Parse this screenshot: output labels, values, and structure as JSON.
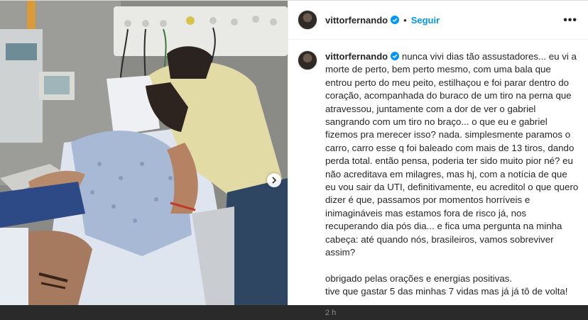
{
  "post": {
    "username": "vittorfernando",
    "follow_label": "Seguir",
    "separator": "•",
    "more_label": "•••",
    "caption_text": "nunca vivi dias tão assustadores... eu vi a morte de perto, bem perto mesmo, com uma bala que entrou perto do meu peito, estilhaçou e foi parar dentro do coração, acompanhada do buraco de um tiro na perna que atravessou, juntamente com a dor de ver o gabriel sangrando com um tiro no braço... o que eu e gabriel fizemos pra merecer isso? nada. simplesmente paramos o carro, carro esse q foi baleado com mais de 13 tiros, dando perda total. então pensa, poderia ter sido muito pior né? eu não acreditava em milagres, mas hj, com a notícia de que eu vou sair da UTI, definitivamente, eu acreditol o que quero dizer é que, passamos por momentos horríveis e inimagináveis mas estamos fora de risco já, nos recuperando dia pós dia... e fica uma pergunta na minha cabeça: até quando nós, brasileiros, vamos sobreviver assim?",
    "caption_line_2": "obrigado pelas orações e energias positivas.",
    "caption_line_3": "tive que gastar 5 das minhas 7 vidas mas já já tô de volta!",
    "time_ago": "2 h",
    "verified_icon": "verified-badge-icon",
    "accent_color": "#0095f6"
  }
}
